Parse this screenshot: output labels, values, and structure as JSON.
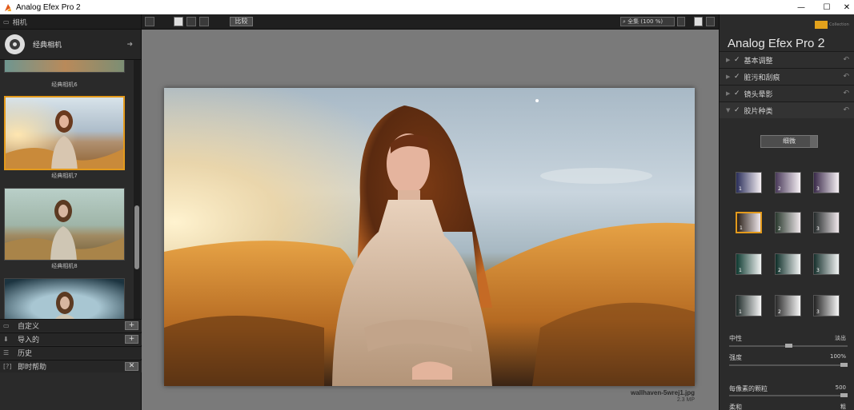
{
  "window": {
    "title": "Analog Efex Pro 2",
    "minimize": "—",
    "maximize": "☐",
    "close": "✕"
  },
  "left": {
    "header": "相机",
    "camera_label": "经典相机",
    "thumbs": [
      {
        "label": "经典相机6"
      },
      {
        "label": "经典相机7",
        "selected": true
      },
      {
        "label": "经典相机8"
      },
      {
        "label": ""
      }
    ],
    "sections": [
      {
        "label": "自定义",
        "btn": "+"
      },
      {
        "label": "导入的",
        "btn": "+"
      },
      {
        "label": "历史",
        "btn": ""
      },
      {
        "label": "即时帮助",
        "btn": "✕"
      }
    ]
  },
  "toolbar": {
    "compare": "比较",
    "zoom": "全集 (100 %)"
  },
  "canvas": {
    "filename": "wallhaven-5wrej1.jpg",
    "megapixels": "2.3 MP"
  },
  "right": {
    "product": "Analog Efex Pro",
    "version": "2",
    "sections": [
      {
        "label": "基本调整"
      },
      {
        "label": "脏污和刮痕"
      },
      {
        "label": "镜头晕影"
      },
      {
        "label": "胶片种类"
      }
    ],
    "film_dropdown": "细微",
    "swatch_numbers": [
      "1",
      "2",
      "3"
    ],
    "params": {
      "neutral_label": "中性",
      "fade_label": "淡出",
      "strength_label": "强度",
      "strength_value": "100%",
      "grain_label": "每像素的颗粒",
      "grain_value": "500",
      "soft_label": "柔和",
      "hard_label": "粗"
    }
  }
}
